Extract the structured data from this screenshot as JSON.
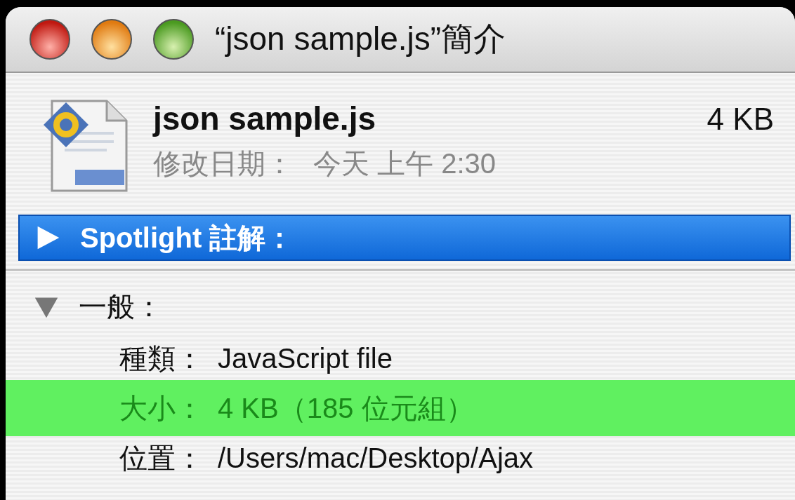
{
  "window": {
    "title": "“json sample.js”簡介"
  },
  "header": {
    "name": "json sample.js",
    "size": "4 KB",
    "modified_label": "修改日期：",
    "modified_value": "今天 上午 2:30"
  },
  "sections": [
    {
      "label": "Spotlight 註解：",
      "expanded": false,
      "selected": true
    },
    {
      "label": "一般：",
      "expanded": true,
      "selected": false
    }
  ],
  "general_rows": [
    {
      "label": "種類：",
      "value": "JavaScript file",
      "selected": false
    },
    {
      "label": "大小：",
      "value": "4 KB（185 位元組）",
      "selected": true
    },
    {
      "label": "位置：",
      "value": "/Users/mac/Desktop/Ajax",
      "selected": false
    }
  ]
}
